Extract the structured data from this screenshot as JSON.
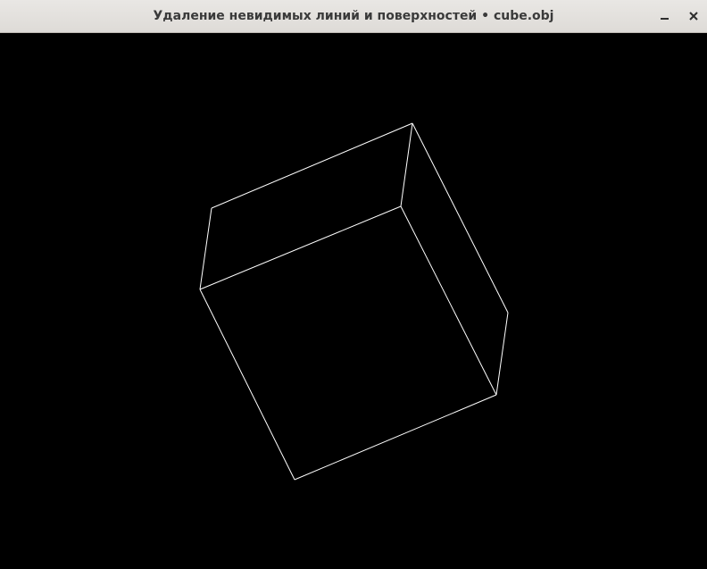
{
  "window": {
    "title": "Удаление невидимых линий и поверхностей • cube.obj",
    "controls": {
      "minimize_icon": "minimize-icon",
      "close_icon": "close-icon"
    }
  },
  "viewport": {
    "background_color": "#000000",
    "edge_color": "#ffffff",
    "render_mode": "wireframe",
    "model": "cube"
  }
}
